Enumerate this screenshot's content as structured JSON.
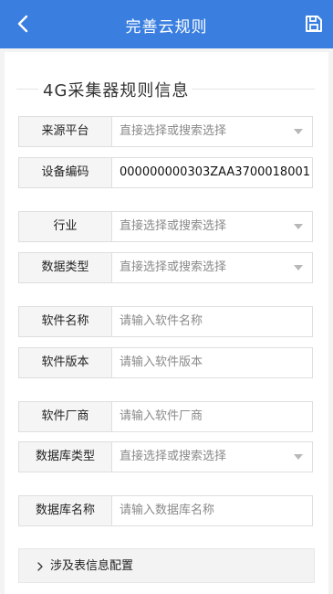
{
  "header": {
    "title": "完善云规则"
  },
  "section": {
    "title": "4G采集器规则信息"
  },
  "fields": [
    {
      "label": "来源平台",
      "value": "直接选择或搜索选择",
      "kind": "select"
    },
    {
      "label": "设备编码",
      "value": "000000000303ZAA3700018001",
      "kind": "text"
    },
    {
      "label": "行业",
      "value": "直接选择或搜索选择",
      "kind": "select"
    },
    {
      "label": "数据类型",
      "value": "直接选择或搜索选择",
      "kind": "select"
    },
    {
      "label": "软件名称",
      "value": "请输入软件名称",
      "kind": "input"
    },
    {
      "label": "软件版本",
      "value": "请输入软件版本",
      "kind": "input"
    },
    {
      "label": "软件厂商",
      "value": "请输入软件厂商",
      "kind": "input"
    },
    {
      "label": "数据库类型",
      "value": "直接选择或搜索选择",
      "kind": "select"
    },
    {
      "label": "数据库名称",
      "value": "请输入数据库名称",
      "kind": "input"
    }
  ],
  "expander": {
    "label": "涉及表信息配置"
  },
  "colors": {
    "header": "#3a7fe0",
    "background": "#f3f3f3",
    "label_bg": "#f5f5f5",
    "placeholder": "#8a8a8a"
  }
}
